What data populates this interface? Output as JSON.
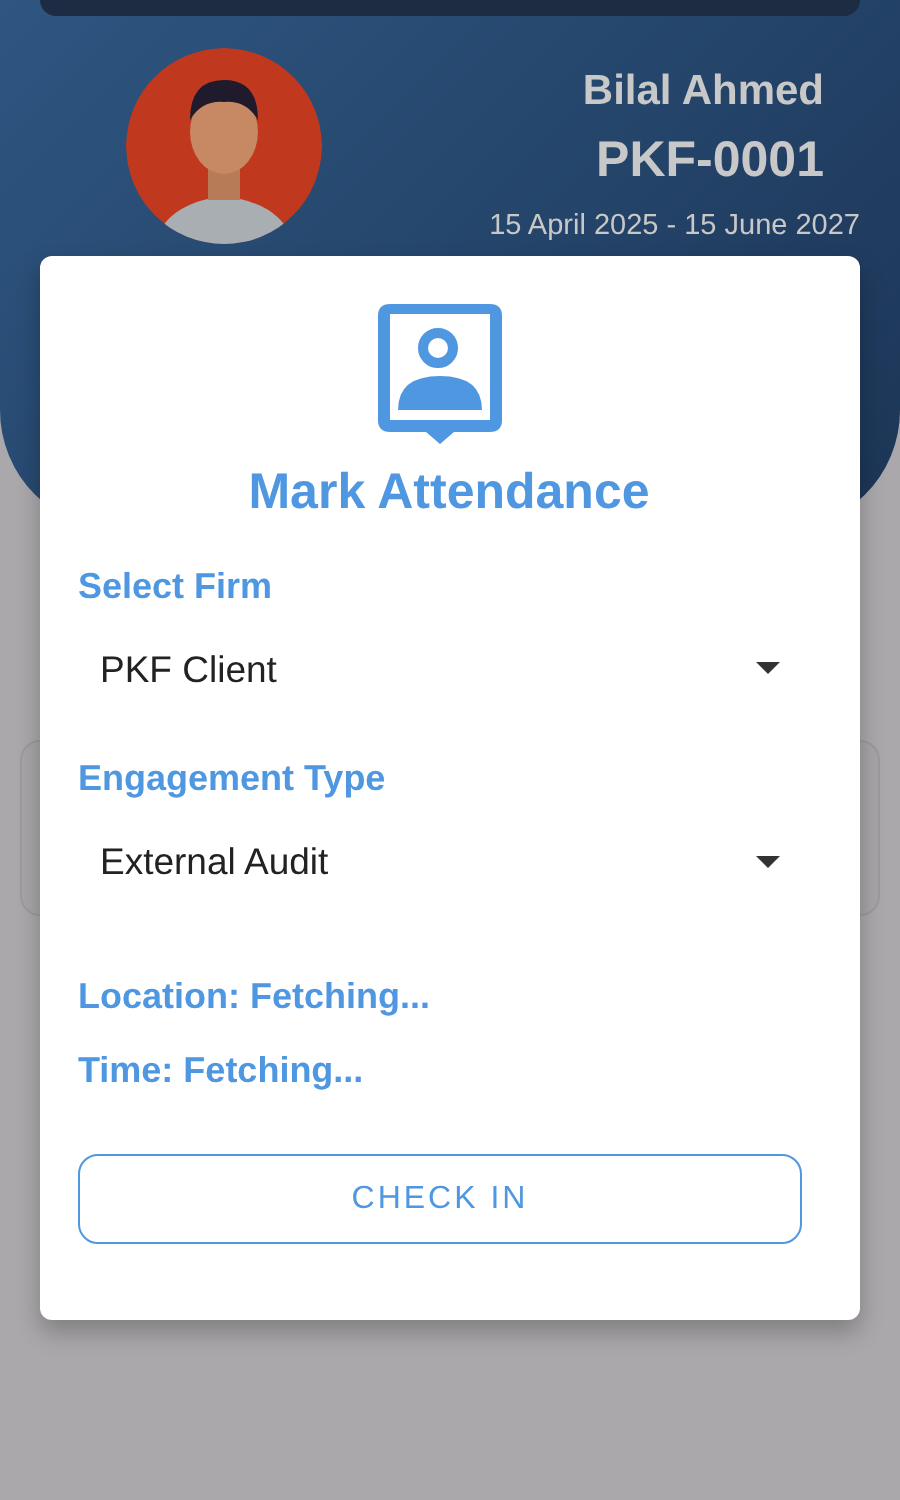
{
  "profile": {
    "name": "Bilal Ahmed",
    "employee_id": "PKF-0001",
    "period": "15 April 2025 - 15 June 2027"
  },
  "dialog": {
    "title": "Mark Attendance",
    "fields": [
      {
        "label": "Select Firm",
        "value": "PKF Client"
      },
      {
        "label": "Engagement Type",
        "value": "External Audit"
      }
    ],
    "status": [
      "Location: Fetching...",
      "Time: Fetching..."
    ],
    "button": "CHECK IN"
  }
}
